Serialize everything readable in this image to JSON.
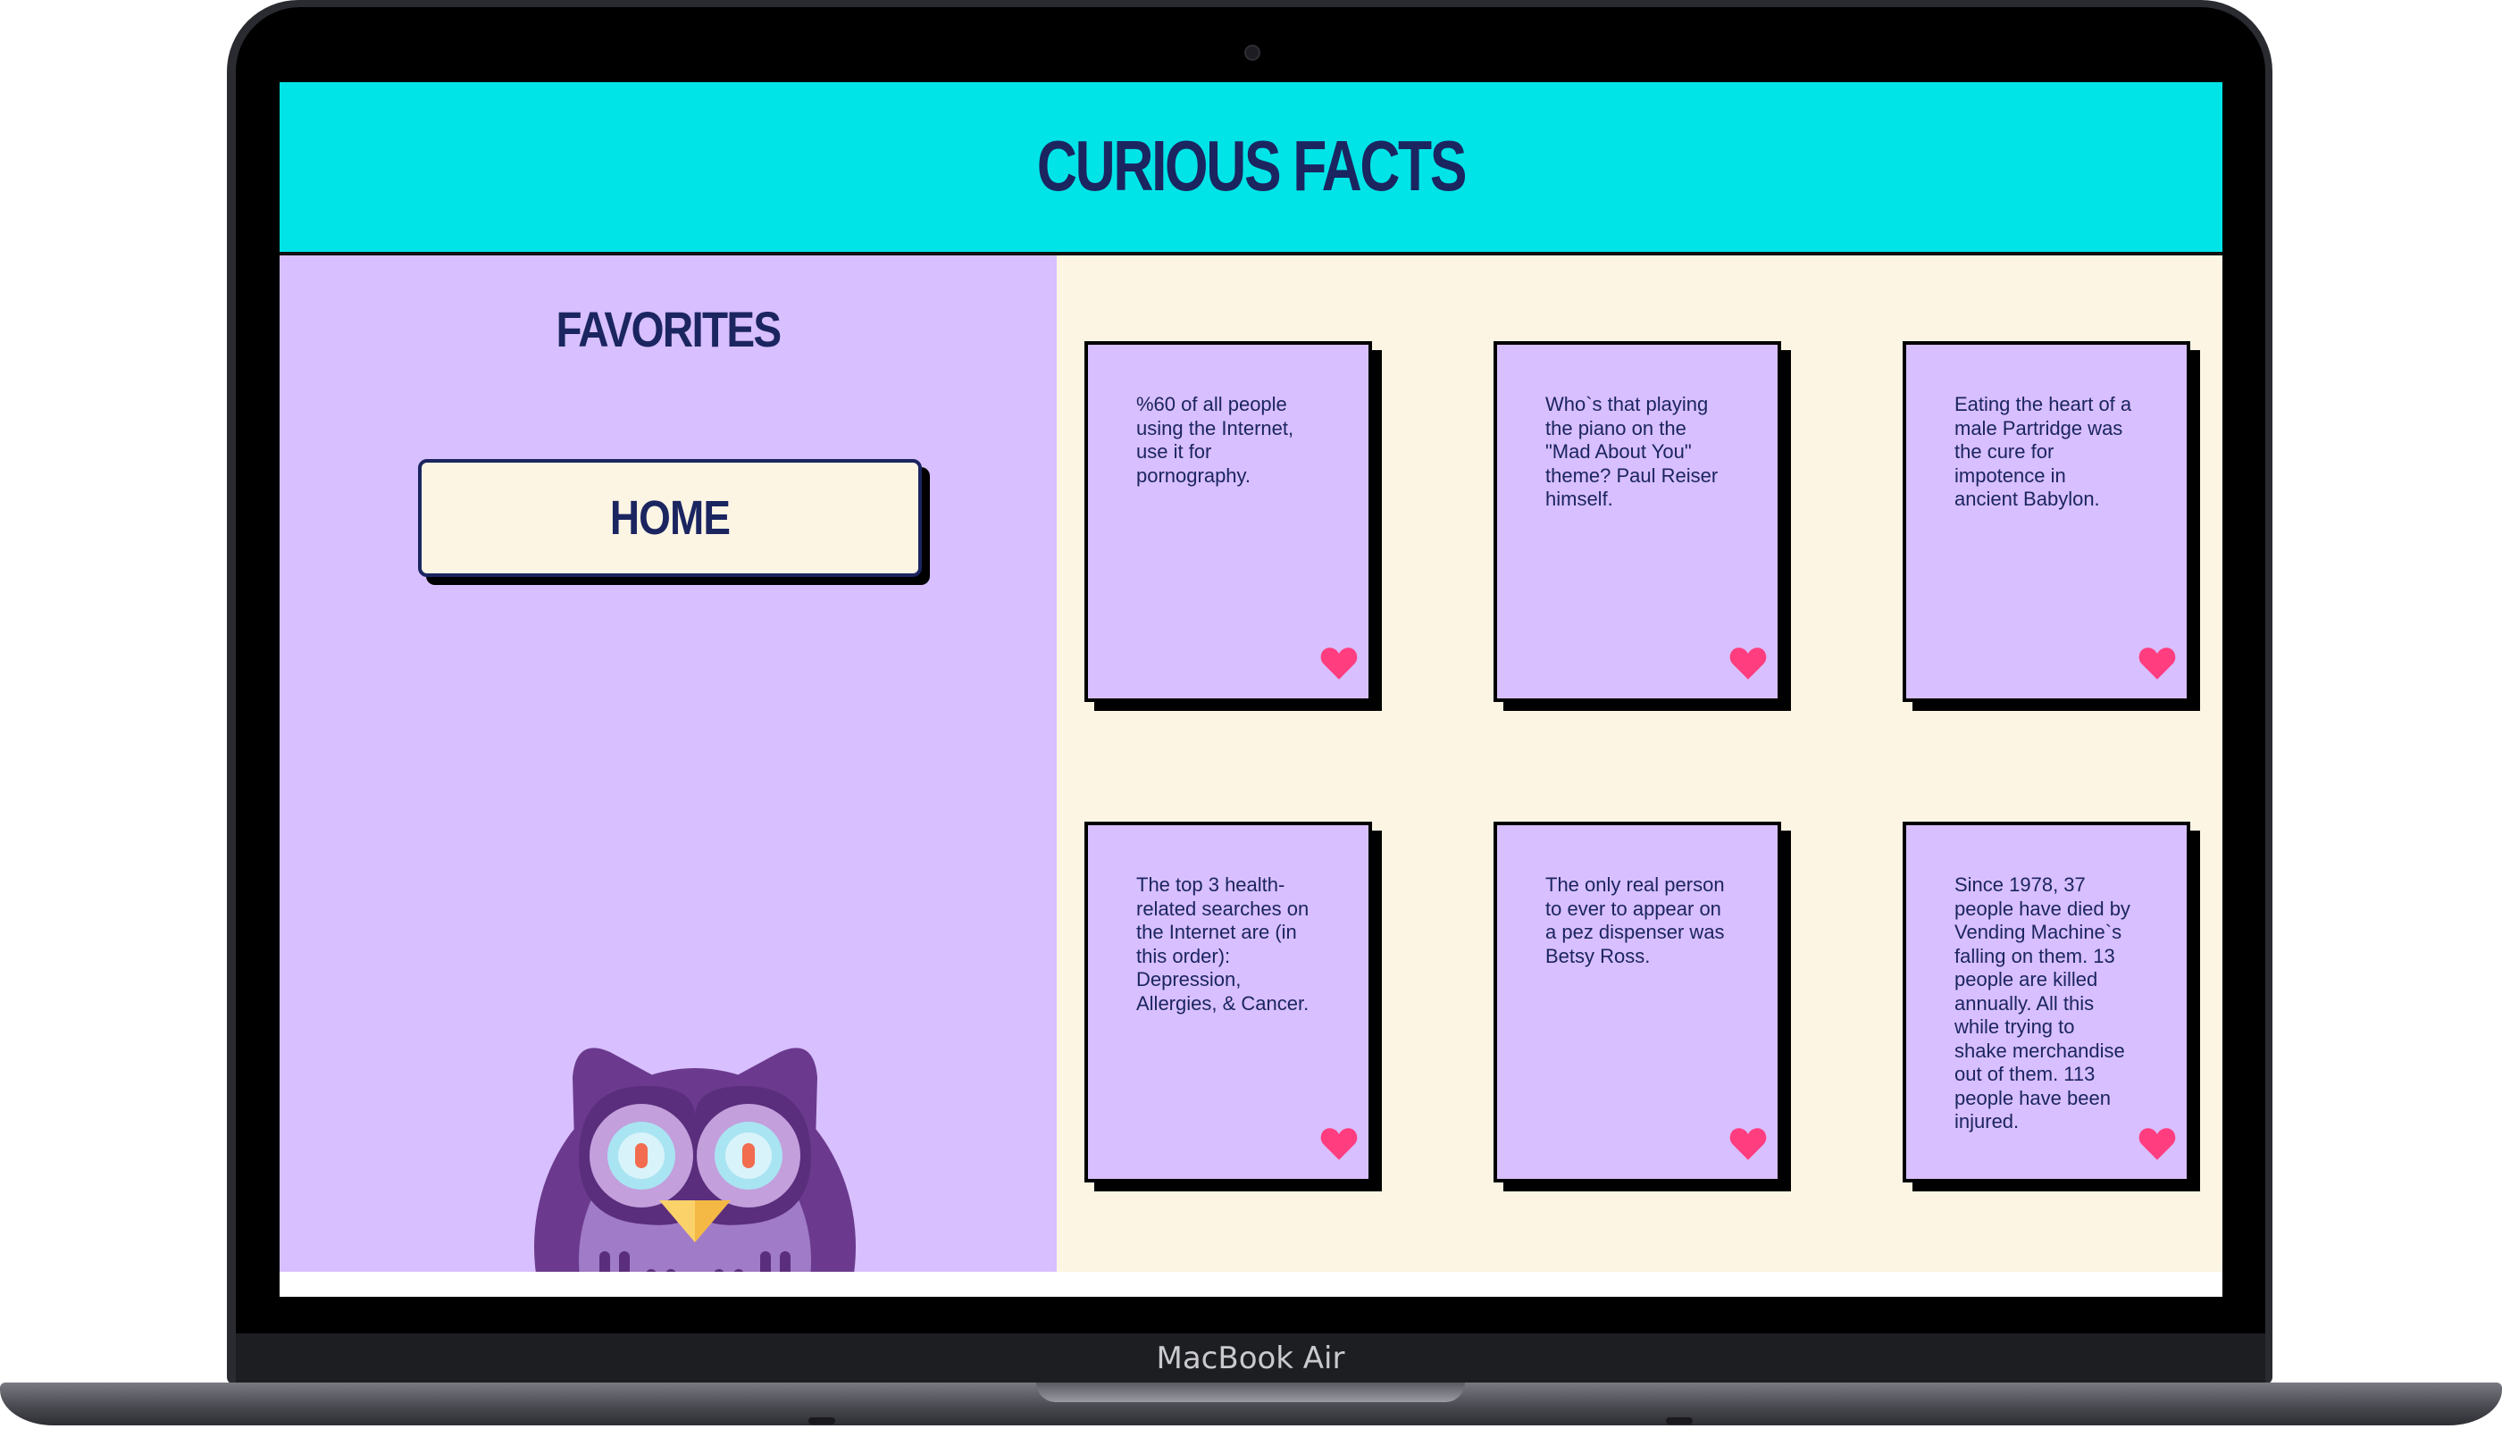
{
  "device": {
    "brand_label": "MacBook Air"
  },
  "header": {
    "title": "CURIOUS FACTS"
  },
  "sidebar": {
    "title": "FAVORITES",
    "home_button": "HOME"
  },
  "colors": {
    "header_bg": "#00e4e8",
    "sidebar_bg": "#d8bfff",
    "content_bg": "#fcf5e4",
    "text_navy": "#1b2560",
    "heart_pink": "#ff3d7f"
  },
  "cards": [
    {
      "text": "%60 of all people\nusing the Internet,\nuse it for\npornography.",
      "icon": "heart-icon"
    },
    {
      "text": "Who`s that playing\nthe piano on the\n\"Mad About You\"\ntheme? Paul Reiser\nhimself.",
      "icon": "heart-icon"
    },
    {
      "text": "Eating the heart of a\nmale Partridge was\nthe cure for\nimpotence in\nancient Babylon.",
      "icon": "heart-icon"
    },
    {
      "text": "The top 3 health-\nrelated searches on\nthe Internet are (in\nthis order):\nDepression,\nAllergies, & Cancer.",
      "icon": "heart-icon"
    },
    {
      "text": "The only real person\nto ever to appear on\na pez dispenser was\nBetsy Ross.",
      "icon": "heart-icon"
    },
    {
      "text": "Since 1978, 37\npeople have died by\nVending Machine`s\nfalling on them.  13\npeople are killed\nannually.  All this\nwhile trying to\nshake merchandise\nout of them. 113\npeople have been\ninjured.",
      "icon": "heart-icon"
    }
  ]
}
